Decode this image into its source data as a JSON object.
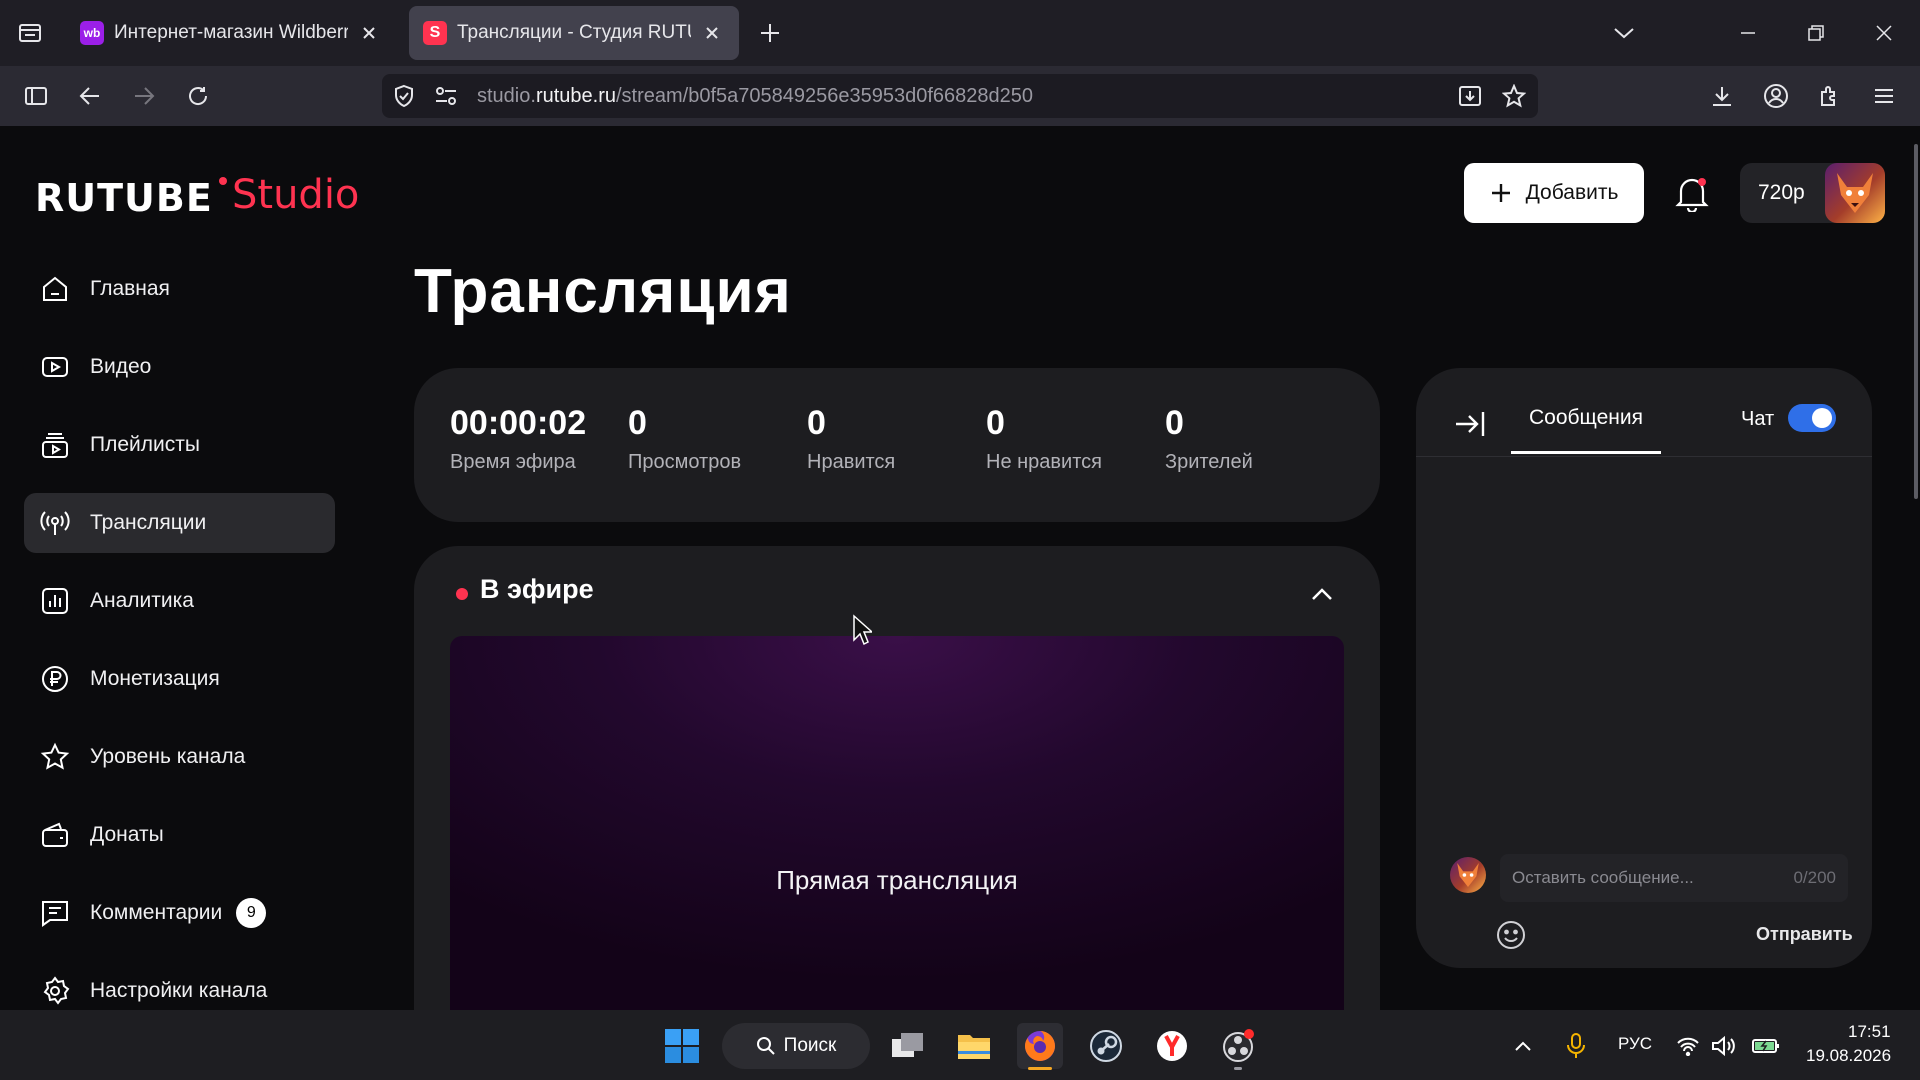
{
  "browser": {
    "tabs": [
      {
        "title": "Интернет-магазин Wildberries:",
        "favicon_text": "wb",
        "active": false
      },
      {
        "title": "Трансляции - Студия RUTUBE",
        "favicon_text": "S",
        "active": true
      }
    ],
    "url_prefix": "studio.",
    "url_domain": "rutube.ru",
    "url_path": "/stream/b0f5a705849256e35953d0f66828d250"
  },
  "header": {
    "logo_brand": "RUTUBE",
    "logo_product": "Studio",
    "add_button_label": "Добавить",
    "quality_label": "720p"
  },
  "sidebar": {
    "items": [
      {
        "label": "Главная",
        "icon": "home-icon"
      },
      {
        "label": "Видео",
        "icon": "video-icon"
      },
      {
        "label": "Плейлисты",
        "icon": "playlist-icon"
      },
      {
        "label": "Трансляции",
        "icon": "broadcast-icon",
        "active": true
      },
      {
        "label": "Аналитика",
        "icon": "analytics-icon"
      },
      {
        "label": "Монетизация",
        "icon": "ruble-icon"
      },
      {
        "label": "Уровень канала",
        "icon": "star-icon"
      },
      {
        "label": "Донаты",
        "icon": "wallet-icon"
      },
      {
        "label": "Комментарии",
        "icon": "comments-icon",
        "badge": "9"
      },
      {
        "label": "Настройки канала",
        "icon": "gear-icon"
      }
    ]
  },
  "main": {
    "title": "Трансляция",
    "stats": [
      {
        "value": "00:00:02",
        "label": "Время эфира"
      },
      {
        "value": "0",
        "label": "Просмотров"
      },
      {
        "value": "0",
        "label": "Нравится"
      },
      {
        "value": "0",
        "label": "Не нравится"
      },
      {
        "value": "0",
        "label": "Зрителей"
      }
    ],
    "live_label": "В эфире",
    "preview_text": "Прямая трансляция"
  },
  "chat": {
    "tab_label": "Сообщения",
    "toggle_label": "Чат",
    "toggle_on": true,
    "input_placeholder": "Оставить сообщение...",
    "char_count": "0/200",
    "send_label": "Отправить"
  },
  "taskbar": {
    "search_label": "Поиск",
    "language": "РУС",
    "time": "17:51",
    "date": "19.08.2026"
  },
  "colors": {
    "accent": "#ff3350",
    "toggle": "#2f6fe8",
    "page_bg": "#0b0b0d",
    "card_bg": "#1d1d20"
  }
}
